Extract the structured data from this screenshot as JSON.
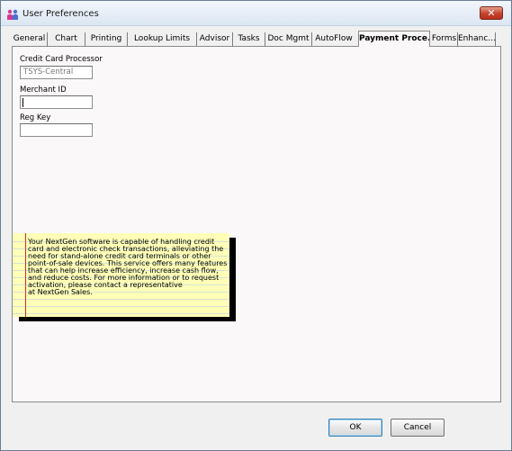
{
  "window": {
    "title": "User Preferences",
    "close_label": "✕"
  },
  "tabs": [
    {
      "label": "General",
      "active": false
    },
    {
      "label": "Chart",
      "active": false
    },
    {
      "label": "Printing",
      "active": false
    },
    {
      "label": "Lookup Limits",
      "active": false
    },
    {
      "label": "Advisor",
      "active": false
    },
    {
      "label": "Tasks",
      "active": false
    },
    {
      "label": "Doc Mgmt",
      "active": false
    },
    {
      "label": "AutoFlow",
      "active": false
    },
    {
      "label": "Payment Proce...",
      "active": true
    },
    {
      "label": "Forms",
      "active": false
    },
    {
      "label": "Enhanc...",
      "active": false
    }
  ],
  "form": {
    "processor_label": "Credit Card Processor",
    "processor_value": "TSYS-Central",
    "merchant_label": "Merchant ID",
    "merchant_value": "",
    "regkey_label": "Reg Key",
    "regkey_value": ""
  },
  "note": {
    "text": "Your NextGen software is capable of handling credit\ncard and electronic check transactions, alleviating the\nneed for stand-alone credit card terminals or other\npoint-of-sale devices. This service offers many features\nthat can help increase efficiency, increase cash flow,\nand reduce costs. For more information or to request\nactivation, please contact a representative\n at NextGen Sales."
  },
  "buttons": {
    "ok": "OK",
    "cancel": "Cancel"
  },
  "icons": {
    "app": "users-icon",
    "close": "close-icon"
  },
  "colors": {
    "note_background": "#ffffb8",
    "note_margin": "#d03030",
    "note_lines": "#a8c7e8",
    "close_button": "#c4412b"
  }
}
